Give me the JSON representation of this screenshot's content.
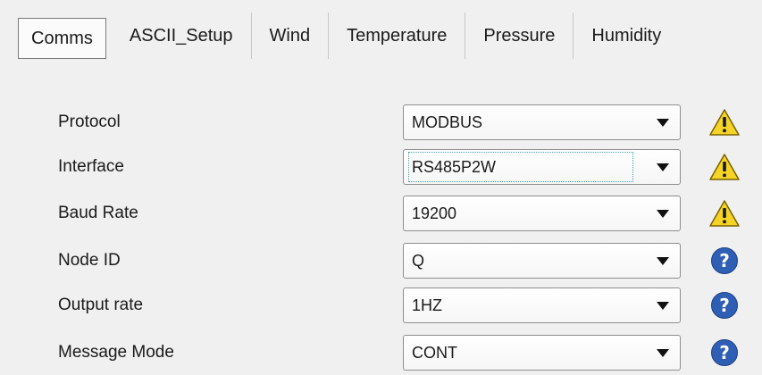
{
  "tabs": [
    {
      "label": "Comms",
      "active": true
    },
    {
      "label": "ASCII_Setup",
      "active": false
    },
    {
      "label": "Wind",
      "active": false
    },
    {
      "label": "Temperature",
      "active": false
    },
    {
      "label": "Pressure",
      "active": false
    },
    {
      "label": "Humidity",
      "active": false
    }
  ],
  "settings": [
    {
      "label": "Protocol",
      "value": "MODBUS",
      "status_icon": "warning-icon"
    },
    {
      "label": "Interface",
      "value": "RS485P2W",
      "status_icon": "warning-icon",
      "focused": true
    },
    {
      "label": "Baud Rate",
      "value": "19200",
      "status_icon": "warning-icon"
    },
    {
      "label": "Node ID",
      "value": "Q",
      "status_icon": "help-icon"
    },
    {
      "label": "Output rate",
      "value": "1HZ",
      "status_icon": "help-icon"
    },
    {
      "label": "Message Mode",
      "value": "CONT",
      "status_icon": "help-icon"
    }
  ],
  "colors": {
    "warning_fill": "#f5d327",
    "help_fill": "#2f5fb4",
    "background": "#f0f0f0"
  }
}
